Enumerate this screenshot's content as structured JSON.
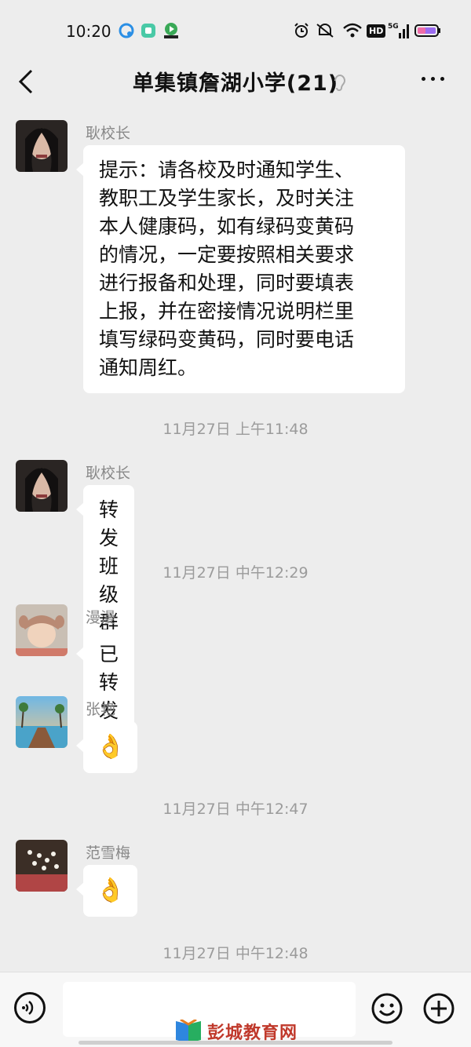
{
  "status_bar": {
    "time": "10:20",
    "icons": [
      "qq-icon",
      "app-icon",
      "video-app-icon",
      "alarm-icon",
      "mute-icon",
      "wifi-icon",
      "hd-icon",
      "signal-5g-icon",
      "battery-icon"
    ],
    "hd_label": "HD",
    "network_label": "5G"
  },
  "header": {
    "title": "单集镇詹湖小学(21)",
    "icons": [
      "back-icon",
      "ear-icon",
      "more-icon"
    ]
  },
  "messages": [
    {
      "sender": "耿校长",
      "lines": [
        "提示：请各校及时通知学生、",
        "教职工及学生家长，及时关注",
        "本人健康码，如有绿码变黄码",
        "的情况，一定要按照相关要求",
        "进行报备和处理，同时要填表",
        "上报，并在密接情况说明栏里",
        "填写绿码变黄码，同时要电话",
        "通知周红。"
      ]
    },
    {
      "timestamp": "11月27日 上午11:48"
    },
    {
      "sender": "耿校长",
      "text": "转发班级群"
    },
    {
      "timestamp": "11月27日 中午12:29"
    },
    {
      "sender": "漫漫",
      "text": "已转发"
    },
    {
      "sender": "张艳",
      "emoji": "👌"
    },
    {
      "timestamp": "11月27日 中午12:47"
    },
    {
      "sender": "范雪梅",
      "emoji": "👌"
    },
    {
      "timestamp": "11月27日 中午12:48"
    }
  ],
  "bottom_bar": {
    "icons": [
      "voice-icon",
      "emoji-icon",
      "plus-icon"
    ],
    "watermark": "彭城教育网"
  },
  "colors": {
    "background": "#ededed",
    "bubble": "#ffffff",
    "timestamp": "#9b9b9b",
    "sender": "#888888"
  }
}
